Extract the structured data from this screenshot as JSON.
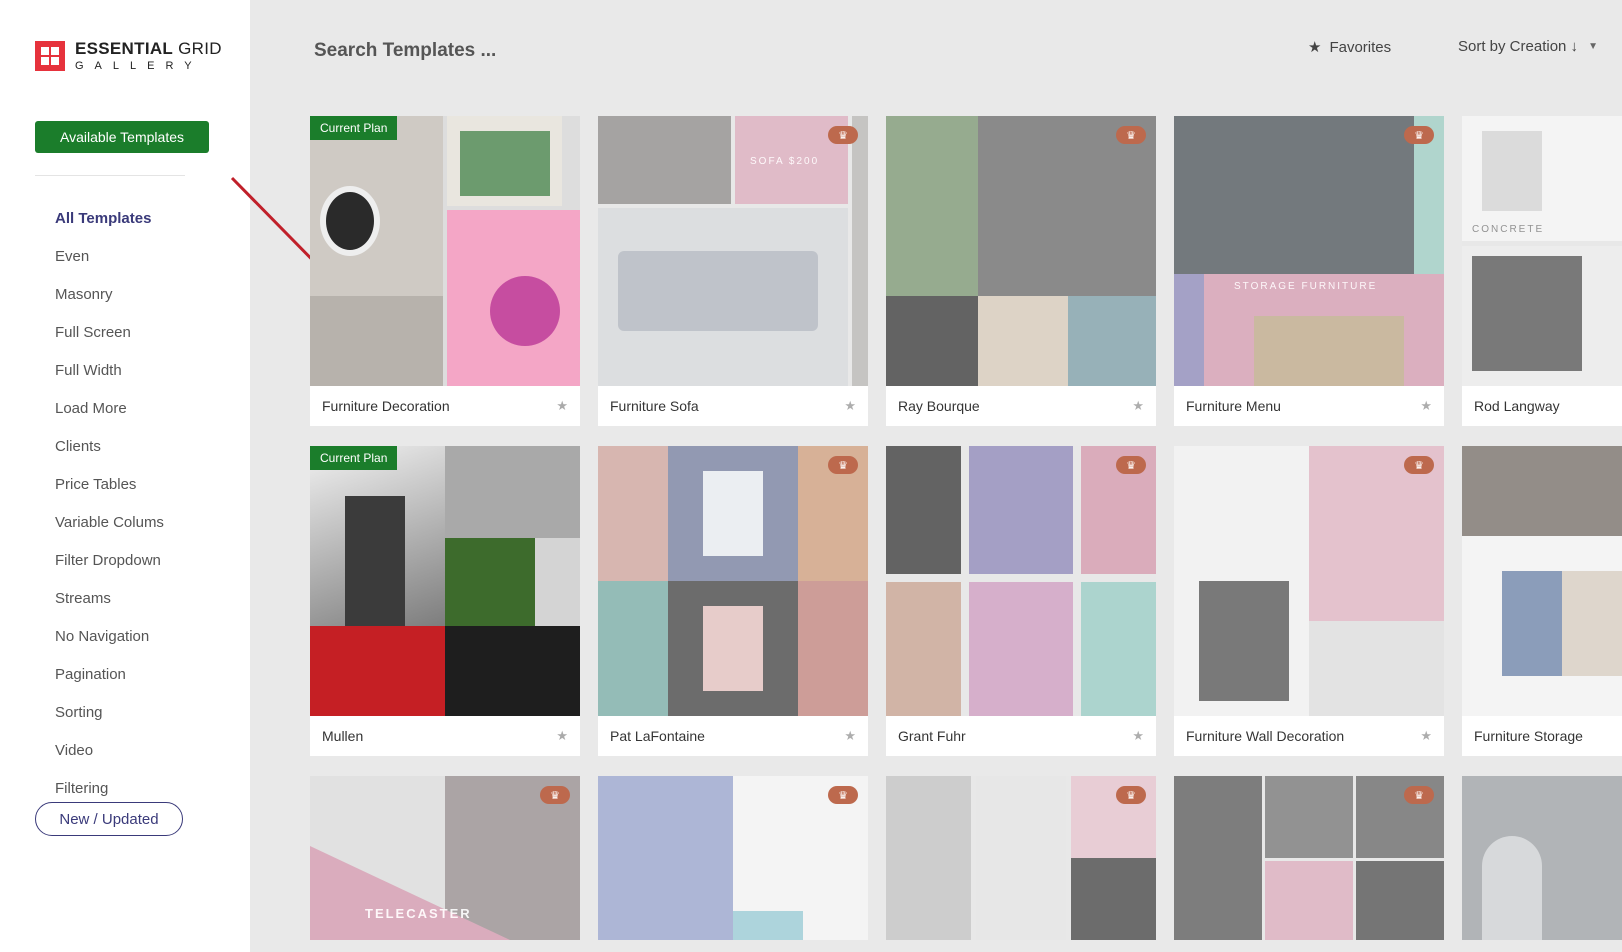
{
  "logo": {
    "brand_bold": "ESSENTIAL",
    "brand_light": "GRID",
    "sub": "GALLERY"
  },
  "sidebar": {
    "primary_button": "Available Templates",
    "items": [
      {
        "label": "All Templates",
        "active": true
      },
      {
        "label": "Even"
      },
      {
        "label": "Masonry"
      },
      {
        "label": "Full Screen"
      },
      {
        "label": "Full Width"
      },
      {
        "label": "Load More"
      },
      {
        "label": "Clients"
      },
      {
        "label": "Price Tables"
      },
      {
        "label": "Variable Colums"
      },
      {
        "label": "Filter Dropdown"
      },
      {
        "label": "Streams"
      },
      {
        "label": "No Navigation"
      },
      {
        "label": "Pagination"
      },
      {
        "label": "Sorting"
      },
      {
        "label": "Video"
      },
      {
        "label": "Filtering"
      }
    ],
    "new_button": "New / Updated"
  },
  "topbar": {
    "search_placeholder": "Search Templates ...",
    "favorites_label": "Favorites",
    "sort_label": "Sort by Creation ↓"
  },
  "badges": {
    "current_plan": "Current Plan",
    "premium_icon": "crown-icon"
  },
  "cards": {
    "c1": {
      "title": "Furniture Decoration"
    },
    "c2": {
      "title": "Furniture Sofa",
      "sofa_price": "SOFA  $200"
    },
    "c3": {
      "title": "Ray Bourque"
    },
    "c4": {
      "title": "Furniture Menu",
      "banner": "STORAGE FURNITURE"
    },
    "c5": {
      "title": "Rod Langway",
      "tag": "CONCRETE"
    },
    "c6": {
      "title": "Mullen"
    },
    "c7": {
      "title": "Pat LaFontaine"
    },
    "c8": {
      "title": "Grant Fuhr"
    },
    "c9": {
      "title": "Furniture Wall Decoration"
    },
    "c10": {
      "title": "Furniture Storage"
    },
    "c11": {
      "title": "",
      "word": "TELECASTER"
    },
    "c12": {
      "title": ""
    },
    "c13": {
      "title": ""
    },
    "c14": {
      "title": ""
    },
    "c15": {
      "title": ""
    }
  },
  "colors": {
    "accent_green": "#1b7d2b",
    "nav_active": "#3a3a7a",
    "crown_orange": "#f05a28",
    "logo_red": "#e6323c",
    "arrow_red": "#c0202a"
  }
}
